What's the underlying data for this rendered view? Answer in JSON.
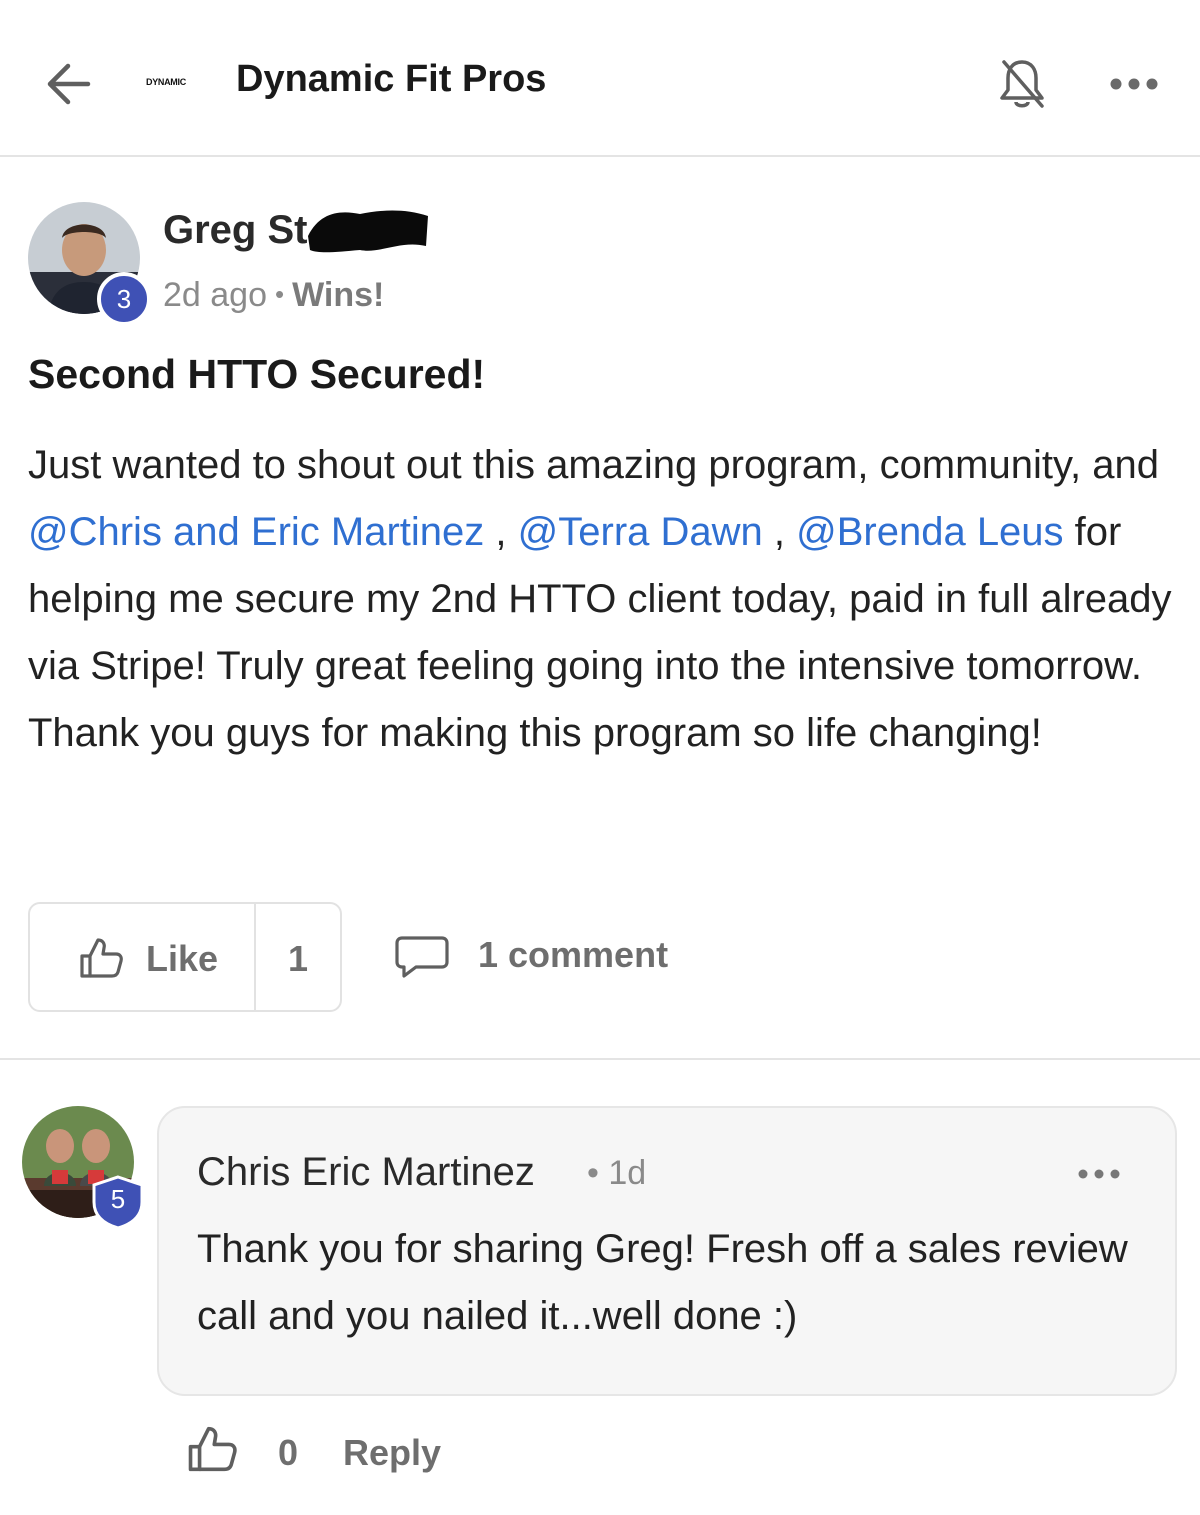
{
  "header": {
    "logo_text": "DYNAMIC",
    "logo_accent_text": "",
    "title": "Dynamic Fit Pros",
    "back_icon": "arrow-left-icon",
    "bell_icon": "bell-off-icon",
    "more_icon": "more-horizontal-icon"
  },
  "post": {
    "author": "Greg St",
    "author_level": "3",
    "time": "2d ago",
    "category": "Wins!",
    "title": "Second HTTO Secured!",
    "body": {
      "text1": "Just wanted to shout out this amazing program, community, and ",
      "mention1": "@Chris and Eric Martinez",
      "sep1": " , ",
      "mention2": "@Terra Dawn",
      "sep2": " , ",
      "mention3": "@Brenda Leus",
      "text2": " for helping me secure my 2nd HTTO client today, paid in full already via Stripe! Truly great feeling going into the intensive tomorrow. Thank you guys for making this program so life changing!"
    },
    "like_label": "Like",
    "like_count": "1",
    "comment_label": "1 comment"
  },
  "comment": {
    "author": "Chris Eric Martinez",
    "author_level": "5",
    "time": "• 1d",
    "text": "Thank you for sharing Greg! Fresh off a sales review call and you nailed it...well done :)",
    "like_count": "0",
    "reply_label": "Reply"
  },
  "colors": {
    "mention": "#2f6fd1",
    "badge": "#3f51b5",
    "muted_text": "#6e6e6e",
    "divider": "#e4e4e4"
  }
}
